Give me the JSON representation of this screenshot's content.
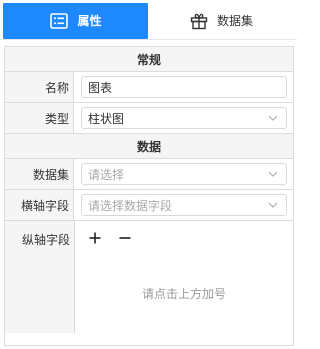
{
  "tabs": [
    {
      "label": "属性",
      "icon": "list-icon",
      "active": true
    },
    {
      "label": "数据集",
      "icon": "gift-icon",
      "active": false
    }
  ],
  "sections": {
    "general_title": "常规",
    "data_title": "数据"
  },
  "fields": {
    "name": {
      "label": "名称",
      "value": "图表"
    },
    "type": {
      "label": "类型",
      "value": "柱状图"
    },
    "dataset": {
      "label": "数据集",
      "placeholder": "请选择"
    },
    "x_axis": {
      "label": "横轴字段",
      "placeholder": "请选择数据字段"
    },
    "y_axis": {
      "label": "纵轴字段",
      "add_symbol": "+",
      "remove_symbol": "−",
      "hint": "请点击上方加号"
    }
  },
  "colors": {
    "accent": "#1e88ff",
    "header_bg": "#f5f5f5",
    "border": "#dcdcdc",
    "placeholder": "#a8a8a8"
  }
}
